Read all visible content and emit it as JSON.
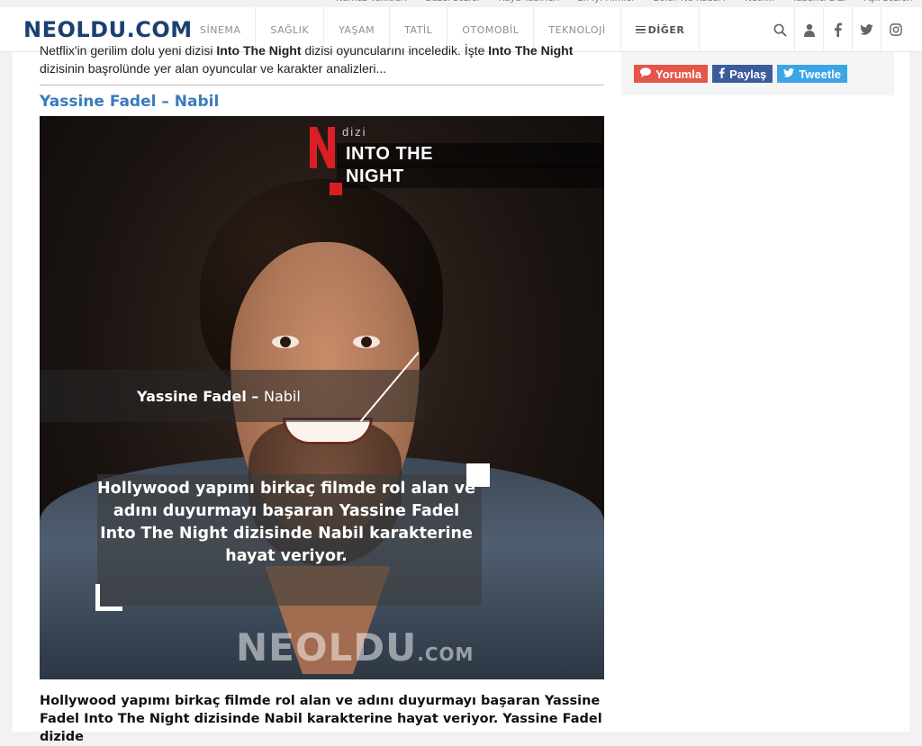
{
  "topbar": {
    "links": [
      "Namaz Vakitleri",
      "Güzel Sözler",
      "Rüya Tabirleri",
      "En İyi Filmler",
      "Bolu? Ne Kadar?",
      "Netflix",
      "Yabancı Dizi",
      "Aşk Sözleri"
    ]
  },
  "header": {
    "logo": "NEOLDU.COM",
    "nav": [
      "SİNEMA",
      "SAĞLIK",
      "YAŞAM",
      "TATİL",
      "OTOMOBİL",
      "TEKNOLOJİ"
    ],
    "more_label": "DİĞER",
    "icons": [
      "search-icon",
      "user-icon",
      "facebook-icon",
      "twitter-icon",
      "instagram-icon"
    ]
  },
  "article": {
    "intro_part1": "Netflix'in gerilim dolu yeni dizisi ",
    "intro_b1": "Into The Night",
    "intro_part2": " dizisi oyuncularını inceledik. İşte ",
    "intro_b2": "Into The Night",
    "intro_part3": " dizisinin başrolünde yer alan oyuncular ve karakter analizleri...",
    "subhead": "Yassine Fadel – Nabil",
    "image": {
      "dizi_label": "dizi",
      "series_title_line1": "INTO THE",
      "series_title_line2": "NIGHT",
      "actor_name": "Yassine Fadel – ",
      "character_name": "Nabil",
      "quote": "Hollywood yapımı birkaç filmde rol alan ve adını duyurmayı başaran Yassine Fadel Into The Night dizisinde Nabil karakterine hayat veriyor.",
      "watermark": "NEOLDU",
      "watermark_suffix": ".COM"
    },
    "caption": "Hollywood yapımı birkaç filmde rol alan ve adını duyurmayı başaran Yassine Fadel Into The Night dizisinde Nabil karakterine hayat veriyor. Yassine Fadel dizide"
  },
  "share": {
    "comment_label": "Yorumla",
    "facebook_label": "Paylaş",
    "twitter_label": "Tweetle"
  },
  "colors": {
    "brand": "#1c3f73",
    "subhead": "#3a7bbd",
    "comment": "#e4554a",
    "facebook": "#3c5b9b",
    "twitter": "#3ba5e6",
    "netflix_red": "#d81f26"
  }
}
